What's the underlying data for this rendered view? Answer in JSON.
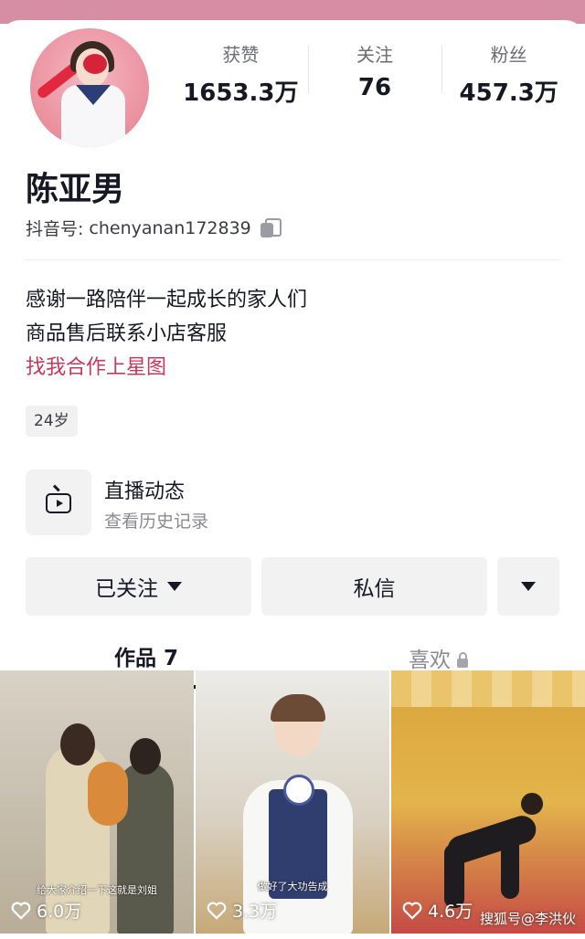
{
  "profile": {
    "name": "陈亚男",
    "account_label": "抖音号:",
    "account_id": "chenyanan172839",
    "age_tag": "24岁"
  },
  "stats": [
    {
      "label": "获赞",
      "value": "1653.3万"
    },
    {
      "label": "关注",
      "value": "76"
    },
    {
      "label": "粉丝",
      "value": "457.3万"
    }
  ],
  "bio": {
    "line1": "感谢一路陪伴一起成长的家人们",
    "line2": "商品售后联系小店客服",
    "link": "找我合作上星图"
  },
  "live": {
    "title": "直播动态",
    "subtitle": "查看历史记录"
  },
  "actions": {
    "follow_label": "已关注",
    "message_label": "私信"
  },
  "tabs": {
    "works": "作品 7",
    "likes": "喜欢"
  },
  "videos": [
    {
      "caption": "给大家介绍一下这就是刘姐",
      "likes": "6.0万"
    },
    {
      "caption": "做好了大功告成",
      "likes": "3.3万"
    },
    {
      "caption": "",
      "likes": "4.6万"
    }
  ],
  "watermark": "搜狐号@李洪伙",
  "colors": {
    "accent_link": "#c6385a",
    "top_band": "#d68ea5",
    "button_bg": "#f2f2f3"
  }
}
